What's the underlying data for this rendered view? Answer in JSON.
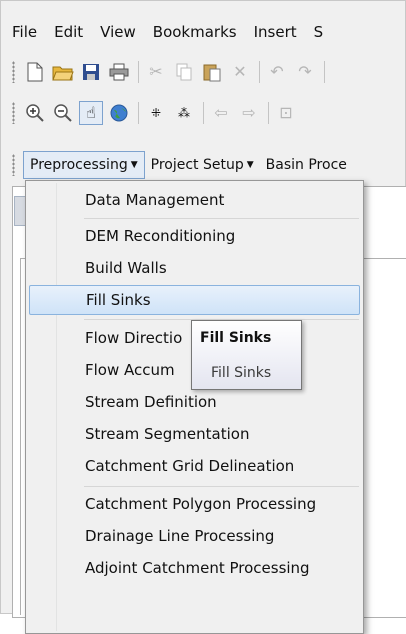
{
  "menubar": {
    "items": [
      "File",
      "Edit",
      "View",
      "Bookmarks",
      "Insert",
      "S"
    ]
  },
  "toolbar1": {
    "icons": [
      "new-document-icon",
      "open-folder-icon",
      "save-icon",
      "print-icon",
      "cut-icon",
      "copy-icon",
      "paste-icon",
      "delete-icon",
      "undo-icon",
      "redo-icon"
    ]
  },
  "toolbar2": {
    "icons": [
      "zoom-in-icon",
      "zoom-out-icon",
      "pan-hand-icon",
      "globe-icon",
      "fixed-zoom-in-icon",
      "fixed-zoom-out-icon",
      "back-arrow-icon",
      "forward-arrow-icon",
      "select-features-icon"
    ]
  },
  "arc_toolbar": {
    "preprocessing": "Preprocessing",
    "project_setup": "Project Setup",
    "basin_processing": "Basin Proce"
  },
  "menu": {
    "items": [
      "Data Management",
      "DEM Reconditioning",
      "Build Walls",
      "Fill Sinks",
      "Flow Directio",
      "Flow Accum",
      "Stream Definition",
      "Stream Segmentation",
      "Catchment Grid Delineation",
      "Catchment Polygon Processing",
      "Drainage Line Processing",
      "Adjoint Catchment Processing"
    ],
    "highlighted": "Fill Sinks"
  },
  "tooltip": {
    "title": "Fill Sinks",
    "body": "Fill Sinks"
  },
  "colors": {
    "highlight_border": "#8ab3de",
    "highlight_fill": "#cfe3f8",
    "menu_bg": "#f0f0f0"
  }
}
